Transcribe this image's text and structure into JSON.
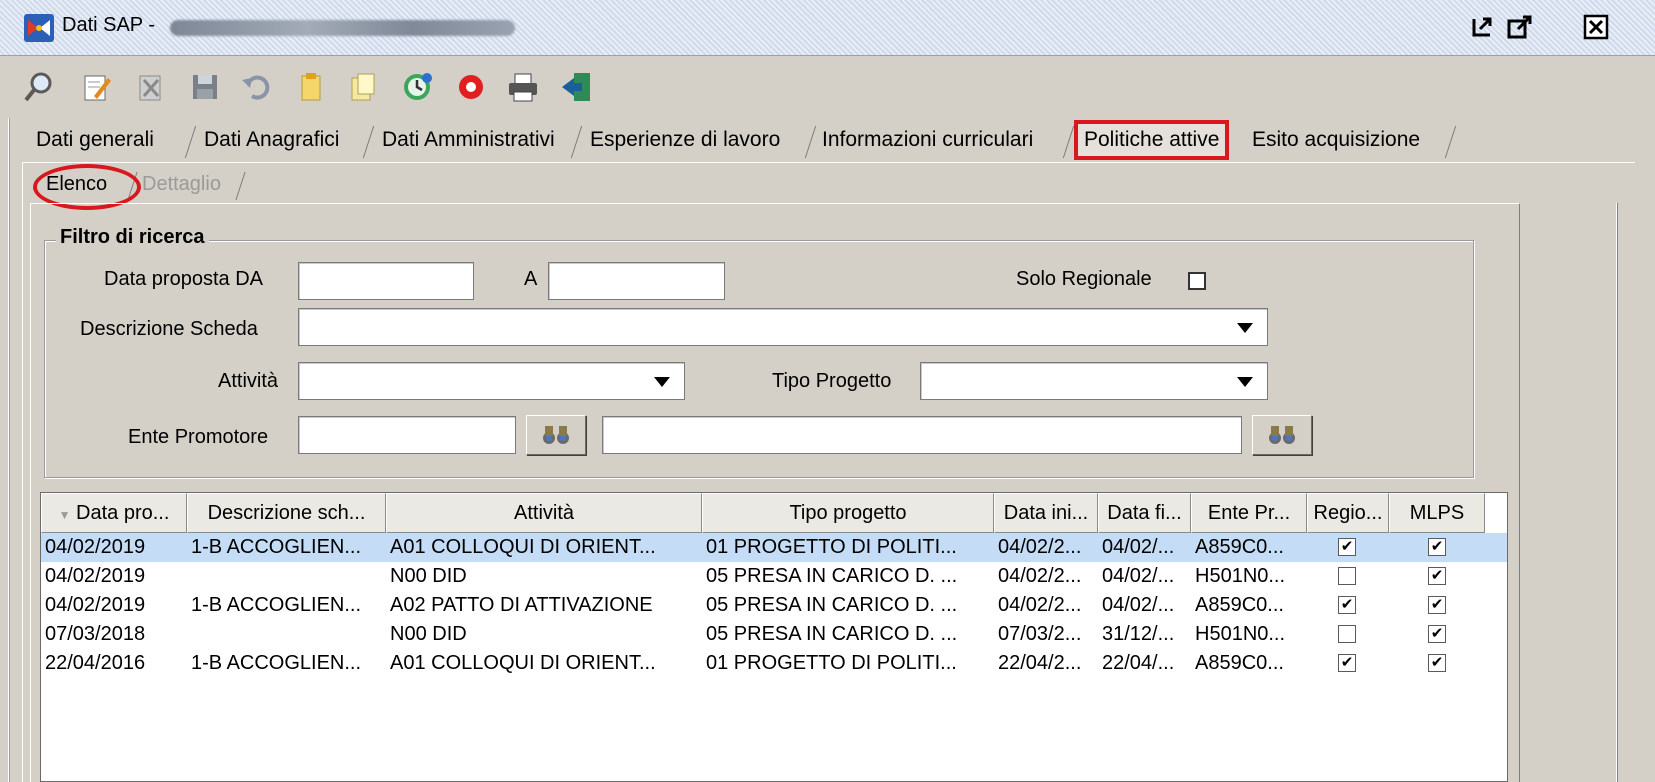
{
  "window": {
    "title": "Dati SAP -",
    "colors": {
      "titlebar": "#cfdaec",
      "highlight": "#d9171e",
      "selected_row": "#c4dcf5"
    }
  },
  "toolbar": {
    "icons": [
      "search-icon",
      "edit-icon",
      "delete-icon",
      "save-icon",
      "undo-icon",
      "new-document-icon",
      "copy-icon",
      "history-icon",
      "stop-icon",
      "print-icon",
      "exit-icon"
    ]
  },
  "tabs": [
    {
      "label": "Dati generali"
    },
    {
      "label": "Dati Anagrafici"
    },
    {
      "label": "Dati Amministrativi"
    },
    {
      "label": "Esperienze di lavoro"
    },
    {
      "label": "Informazioni curriculari"
    },
    {
      "label": "Politiche attive",
      "selected": true
    },
    {
      "label": "Esito acquisizione"
    }
  ],
  "subtabs": [
    {
      "label": "Elenco",
      "selected": true
    },
    {
      "label": "Dettaglio",
      "enabled": false
    }
  ],
  "filter": {
    "title": "Filtro di ricerca",
    "data_proposta_da_label": "Data proposta DA",
    "data_proposta_da_value": "",
    "a_label": "A",
    "a_value": "",
    "solo_regionale_label": "Solo Regionale",
    "solo_regionale_checked": false,
    "descrizione_scheda_label": "Descrizione Scheda",
    "descrizione_scheda_value": "",
    "attivita_label": "Attività",
    "attivita_value": "",
    "tipo_progetto_label": "Tipo Progetto",
    "tipo_progetto_value": "",
    "ente_promotore_label": "Ente Promotore",
    "ente_promotore_code": "",
    "ente_promotore_desc": ""
  },
  "table": {
    "columns": [
      "Data pro...",
      "Descrizione sch...",
      "Attività",
      "Tipo progetto",
      "Data ini...",
      "Data fi...",
      "Ente Pr...",
      "Regio...",
      "MLPS"
    ],
    "rows": [
      {
        "data_proposta": "04/02/2019",
        "descrizione": "1-B ACCOGLIEN...",
        "attivita": "A01 COLLOQUI DI ORIENT...",
        "tipo_progetto": "01 PROGETTO DI POLITI...",
        "data_inizio": "04/02/2...",
        "data_fine": "04/02/...",
        "ente": "A859C0...",
        "regionale": true,
        "mlps": true,
        "selected": true
      },
      {
        "data_proposta": "04/02/2019",
        "descrizione": "",
        "attivita": "N00 DID",
        "tipo_progetto": "05 PRESA IN CARICO D. ...",
        "data_inizio": "04/02/2...",
        "data_fine": "04/02/...",
        "ente": "H501N0...",
        "regionale": false,
        "mlps": true
      },
      {
        "data_proposta": "04/02/2019",
        "descrizione": "1-B ACCOGLIEN...",
        "attivita": "A02 PATTO DI ATTIVAZIONE",
        "tipo_progetto": "05 PRESA IN CARICO D. ...",
        "data_inizio": "04/02/2...",
        "data_fine": "04/02/...",
        "ente": "A859C0...",
        "regionale": true,
        "mlps": true
      },
      {
        "data_proposta": "07/03/2018",
        "descrizione": "",
        "attivita": "N00 DID",
        "tipo_progetto": "05 PRESA IN CARICO D. ...",
        "data_inizio": "07/03/2...",
        "data_fine": "31/12/...",
        "ente": "H501N0...",
        "regionale": false,
        "mlps": true
      },
      {
        "data_proposta": "22/04/2016",
        "descrizione": "1-B ACCOGLIEN...",
        "attivita": "A01 COLLOQUI DI ORIENT...",
        "tipo_progetto": "01 PROGETTO DI POLITI...",
        "data_inizio": "22/04/2...",
        "data_fine": "22/04/...",
        "ente": "A859C0...",
        "regionale": true,
        "mlps": true
      }
    ]
  }
}
